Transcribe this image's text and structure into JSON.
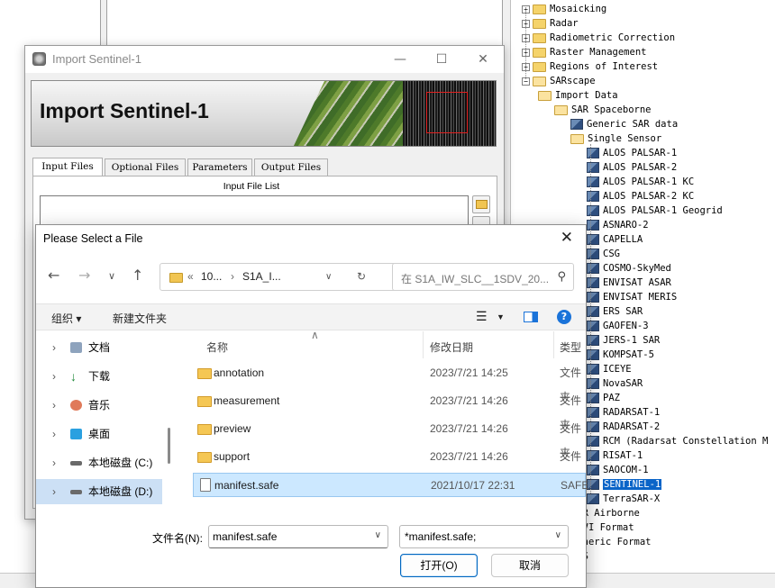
{
  "colors": {
    "accent": "#0067c0",
    "selection": "#cce8ff",
    "tree_selection": "#0a64c8"
  },
  "tree": {
    "items": [
      {
        "label": "Mosaicking",
        "type": "folder"
      },
      {
        "label": "Radar",
        "type": "folder"
      },
      {
        "label": "Radiometric Correction",
        "type": "folder"
      },
      {
        "label": "Raster Management",
        "type": "folder"
      },
      {
        "label": "Regions of Interest",
        "type": "folder"
      },
      {
        "label": "SARscape",
        "type": "folder-open"
      },
      {
        "label": "Import Data",
        "type": "folder-open"
      },
      {
        "label": "SAR Spaceborne",
        "type": "folder-open"
      },
      {
        "label": "Generic SAR data",
        "type": "tool"
      },
      {
        "label": "Single Sensor",
        "type": "folder-open"
      },
      {
        "label": "ALOS PALSAR-1",
        "type": "tool"
      },
      {
        "label": "ALOS PALSAR-2",
        "type": "tool"
      },
      {
        "label": "ALOS PALSAR-1 KC",
        "type": "tool"
      },
      {
        "label": "ALOS PALSAR-2 KC",
        "type": "tool"
      },
      {
        "label": "ALOS PALSAR-1 Geogrid",
        "type": "tool"
      },
      {
        "label": "ASNARO-2",
        "type": "tool"
      },
      {
        "label": "CAPELLA",
        "type": "tool"
      },
      {
        "label": "CSG",
        "type": "tool"
      },
      {
        "label": "COSMO-SkyMed",
        "type": "tool"
      },
      {
        "label": "ENVISAT ASAR",
        "type": "tool"
      },
      {
        "label": "ENVISAT MERIS",
        "type": "tool"
      },
      {
        "label": "ERS SAR",
        "type": "tool"
      },
      {
        "label": "GAOFEN-3",
        "type": "tool"
      },
      {
        "label": "JERS-1 SAR",
        "type": "tool"
      },
      {
        "label": "KOMPSAT-5",
        "type": "tool"
      },
      {
        "label": "ICEYE",
        "type": "tool"
      },
      {
        "label": "NovaSAR",
        "type": "tool"
      },
      {
        "label": "PAZ",
        "type": "tool"
      },
      {
        "label": "RADARSAT-1",
        "type": "tool"
      },
      {
        "label": "RADARSAT-2",
        "type": "tool"
      },
      {
        "label": "RCM (Radarsat Constellation M",
        "type": "tool"
      },
      {
        "label": "RISAT-1",
        "type": "tool"
      },
      {
        "label": "SAOCOM-1",
        "type": "tool"
      },
      {
        "label": "SENTINEL-1",
        "type": "tool",
        "selected": true
      },
      {
        "label": "TerraSAR-X",
        "type": "tool"
      },
      {
        "label": "SAR Airborne",
        "type": "folder"
      },
      {
        "label": "ENVI Format",
        "type": "folder"
      },
      {
        "label": "Generic Format",
        "type": "folder"
      },
      {
        "label": "GPS",
        "type": "folder"
      }
    ]
  },
  "import_window": {
    "title": "Import Sentinel-1",
    "banner_title": "Import Sentinel-1",
    "tabs": [
      "Input Files",
      "Optional Files",
      "Parameters",
      "Output Files"
    ],
    "active_tab": "Input Files",
    "list_label": "Input File List"
  },
  "dialog": {
    "title": "Please Select a File",
    "address": {
      "root": "10...",
      "folder": "S1A_I..."
    },
    "search_placeholder": "在 S1A_IW_SLC__1SDV_20...",
    "toolbar": {
      "organize": "组织 ▾",
      "new_folder": "新建文件夹"
    },
    "nav": [
      {
        "label": "文档",
        "icon": "documents-icon"
      },
      {
        "label": "下载",
        "icon": "downloads-icon"
      },
      {
        "label": "音乐",
        "icon": "music-icon"
      },
      {
        "label": "桌面",
        "icon": "desktop-icon"
      },
      {
        "label": "本地磁盘 (C:)",
        "icon": "drive-icon"
      },
      {
        "label": "本地磁盘 (D:)",
        "icon": "drive-icon",
        "selected": true
      }
    ],
    "columns": {
      "name": "名称",
      "date": "修改日期",
      "type": "类型"
    },
    "files": [
      {
        "name": "annotation",
        "date": "2023/7/21 14:25",
        "type": "文件夹",
        "kind": "folder"
      },
      {
        "name": "measurement",
        "date": "2023/7/21 14:26",
        "type": "文件夹",
        "kind": "folder"
      },
      {
        "name": "preview",
        "date": "2023/7/21 14:26",
        "type": "文件夹",
        "kind": "folder"
      },
      {
        "name": "support",
        "date": "2023/7/21 14:26",
        "type": "文件夹",
        "kind": "folder"
      },
      {
        "name": "manifest.safe",
        "date": "2021/10/17 22:31",
        "type": "SAFE",
        "kind": "file",
        "selected": true
      }
    ],
    "filename_label": "文件名(N):",
    "filename_value": "manifest.safe",
    "filetype_value": "*manifest.safe;",
    "open_label": "打开(O)",
    "cancel_label": "取消"
  }
}
